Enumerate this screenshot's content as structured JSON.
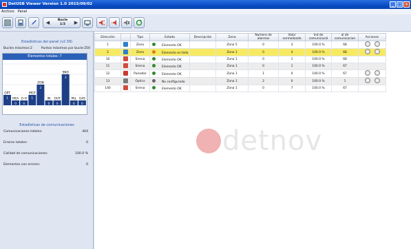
{
  "window": {
    "title": "DetUSB Viewer Version 1.0 2015/09/02",
    "min": "_",
    "max": "□",
    "close": "×"
  },
  "menu": [
    "Archivo",
    "Panel"
  ],
  "pager": {
    "line1": "Bucle",
    "line2": "1/2"
  },
  "left": {
    "panel_title": "Estadísticas del panel (v2.39)",
    "loops_max": "Bucles máximos:2",
    "points_max": "Puntos máximos por bucle:250",
    "chart": {
      "title": "Elementos totales: 7",
      "bars": [
        {
          "label": "OPT",
          "value": 1,
          "count": "1"
        },
        {
          "label": "HEA",
          "value": 0,
          "count": "0"
        },
        {
          "label": "O-H",
          "value": 0,
          "count": "0"
        },
        {
          "label": "MCP",
          "value": 1,
          "count": "1"
        },
        {
          "label": "ZON",
          "value": 2,
          "count": "2"
        },
        {
          "label": "IN",
          "value": 0,
          "count": "0"
        },
        {
          "label": "OUT",
          "value": 0,
          "count": "0"
        },
        {
          "label": "SND",
          "value": 3,
          "count": "3"
        },
        {
          "label": "PAL",
          "value": 0,
          "count": "0"
        },
        {
          "label": "GAS",
          "value": 0,
          "count": "0"
        }
      ]
    },
    "stats_title": "Estadísticas de comunicaciones",
    "stats": [
      {
        "label": "Comunicaciones totales:",
        "value": "404"
      },
      {
        "label": "Errores totales:",
        "value": "0"
      },
      {
        "label": "Calidad de comunicaciones:",
        "value": "100.0 %"
      },
      {
        "label": "Elementos con errores:",
        "value": "0"
      }
    ]
  },
  "table": {
    "headers": [
      "Dirección",
      "Tipo",
      "Estado",
      "Descripción",
      "Zona",
      "Numero de alarmas",
      "Valor normalizado",
      "Ind de comunicació",
      "al de comunicacion",
      "Acciones"
    ],
    "rows": [
      {
        "dir": "1",
        "tipo": "Zona",
        "estado": "Elemento OK",
        "desc": "",
        "zona": "Zona 5",
        "alarmas": "0",
        "valor": "3",
        "ind": "100.0 %",
        "al": "68",
        "icon": "#2e7fcf",
        "dot": "#2d8a2d",
        "acts": 2,
        "cls": ""
      },
      {
        "dir": "2",
        "tipo": "Zona",
        "estado": "Elemento en fallo",
        "desc": "",
        "zona": "Zona 1",
        "alarmas": "0",
        "valor": "4",
        "ind": "100.0 %",
        "al": "68",
        "icon": "#2e7fcf",
        "dot": "#d77a1c",
        "acts": 2,
        "cls": "sel"
      },
      {
        "dir": "10",
        "tipo": "Sirena",
        "estado": "Elemento OK",
        "desc": "",
        "zona": "Zona 1",
        "alarmas": "0",
        "valor": "1",
        "ind": "100.0 %",
        "al": "68",
        "icon": "#d24b3c",
        "dot": "#2d8a2d",
        "acts": 0,
        "cls": ""
      },
      {
        "dir": "11",
        "tipo": "Sirena",
        "estado": "Elemento OK",
        "desc": "",
        "zona": "Zona 1",
        "alarmas": "0",
        "valor": "1",
        "ind": "100.0 %",
        "al": "67",
        "icon": "#d24b3c",
        "dot": "#2d8a2d",
        "acts": 0,
        "cls": "grey"
      },
      {
        "dir": "12",
        "tipo": "Pulsador",
        "estado": "Elemento OK",
        "desc": "",
        "zona": "Zona 1",
        "alarmas": "1",
        "valor": "0",
        "ind": "100.0 %",
        "al": "67",
        "icon": "#c93a2f",
        "dot": "#2d8a2d",
        "acts": 2,
        "cls": ""
      },
      {
        "dir": "13",
        "tipo": "Óptico",
        "estado": "No configurado",
        "desc": "",
        "zona": "Zona 1",
        "alarmas": "2",
        "valor": "0",
        "ind": "100.0 %",
        "al": "1",
        "icon": "#7a7a7a",
        "dot": "#666666",
        "acts": 2,
        "cls": "grey"
      },
      {
        "dir": "140",
        "tipo": "Sirena",
        "estado": "Elemento OK",
        "desc": "",
        "zona": "Zona 1",
        "alarmas": "0",
        "valor": "7",
        "ind": "100.0 %",
        "al": "67",
        "icon": "#d24b3c",
        "dot": "#2d8a2d",
        "acts": 0,
        "cls": ""
      }
    ]
  },
  "logo": "detnov"
}
